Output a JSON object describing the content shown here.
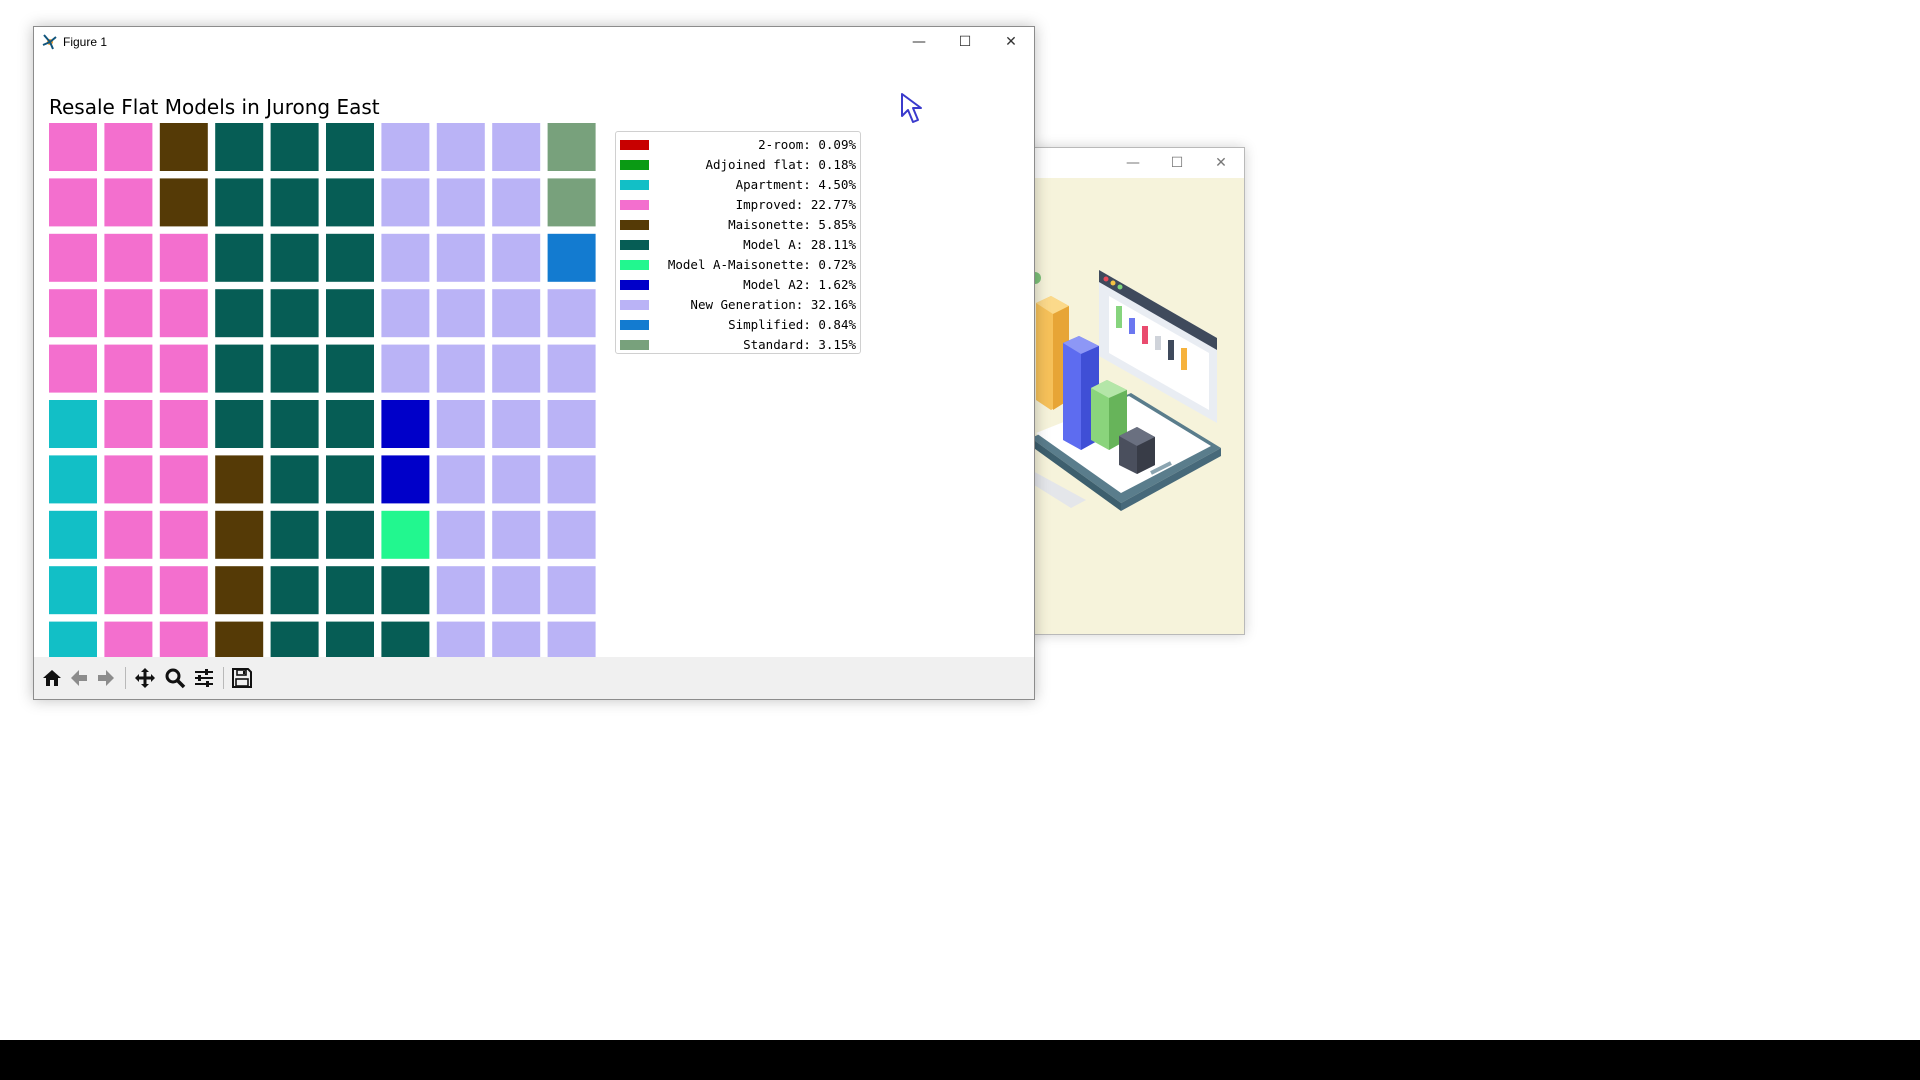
{
  "main_window": {
    "title": "Figure 1",
    "controls": {
      "minimize": "—",
      "maximize": "☐",
      "close": "✕"
    }
  },
  "back_window": {
    "controls": {
      "minimize": "—",
      "maximize": "☐",
      "close": "✕"
    },
    "illustration": "isometric-dashboard-illustration"
  },
  "toolbar": {
    "buttons": [
      "home-icon",
      "back-arrow-icon",
      "forward-arrow-icon",
      "pan-icon",
      "zoom-icon",
      "configure-subplots-icon",
      "save-icon"
    ]
  },
  "chart_data": {
    "type": "waffle",
    "title": "Resale Flat Models in Jurong East",
    "rows": 10,
    "columns": 10,
    "legend_placement": "upper-right",
    "categories": [
      {
        "name": "2-room",
        "label": "2-room: 0.09%",
        "percent": 0.09,
        "color": "#c80000"
      },
      {
        "name": "Adjoined flat",
        "label": "Adjoined flat: 0.18%",
        "percent": 0.18,
        "color": "#0a9a14"
      },
      {
        "name": "Apartment",
        "label": "Apartment: 4.50%",
        "percent": 4.5,
        "color": "#12bfc6"
      },
      {
        "name": "Improved",
        "label": "Improved: 22.77%",
        "percent": 22.77,
        "color": "#f36fce"
      },
      {
        "name": "Maisonette",
        "label": "Maisonette: 5.85%",
        "percent": 5.85,
        "color": "#553a06"
      },
      {
        "name": "Model A",
        "label": "Model A: 28.11%",
        "percent": 28.11,
        "color": "#065d55"
      },
      {
        "name": "Model A-Maisonette",
        "label": "Model A-Maisonette: 0.72%",
        "percent": 0.72,
        "color": "#22f78f"
      },
      {
        "name": "Model A2",
        "label": "Model A2: 1.62%",
        "percent": 1.62,
        "color": "#0000c9"
      },
      {
        "name": "New Generation",
        "label": "New Generation: 32.16%",
        "percent": 32.16,
        "color": "#bab3f6"
      },
      {
        "name": "Simplified",
        "label": "Simplified: 0.84%",
        "percent": 0.84,
        "color": "#137bd0"
      },
      {
        "name": "Standard",
        "label": "Standard: 3.15%",
        "percent": 3.15,
        "color": "#78a17c"
      }
    ],
    "grid": [
      [
        "Improved",
        "Improved",
        "Maisonette",
        "Model A",
        "Model A",
        "Model A",
        "New Generation",
        "New Generation",
        "New Generation",
        "Standard"
      ],
      [
        "Improved",
        "Improved",
        "Maisonette",
        "Model A",
        "Model A",
        "Model A",
        "New Generation",
        "New Generation",
        "New Generation",
        "Standard"
      ],
      [
        "Improved",
        "Improved",
        "Improved",
        "Model A",
        "Model A",
        "Model A",
        "New Generation",
        "New Generation",
        "New Generation",
        "Simplified"
      ],
      [
        "Improved",
        "Improved",
        "Improved",
        "Model A",
        "Model A",
        "Model A",
        "New Generation",
        "New Generation",
        "New Generation",
        "New Generation"
      ],
      [
        "Improved",
        "Improved",
        "Improved",
        "Model A",
        "Model A",
        "Model A",
        "New Generation",
        "New Generation",
        "New Generation",
        "New Generation"
      ],
      [
        "Apartment",
        "Improved",
        "Improved",
        "Model A",
        "Model A",
        "Model A",
        "Model A2",
        "New Generation",
        "New Generation",
        "New Generation"
      ],
      [
        "Apartment",
        "Improved",
        "Improved",
        "Maisonette",
        "Model A",
        "Model A",
        "Model A2",
        "New Generation",
        "New Generation",
        "New Generation"
      ],
      [
        "Apartment",
        "Improved",
        "Improved",
        "Maisonette",
        "Model A",
        "Model A",
        "Model A-Maisonette",
        "New Generation",
        "New Generation",
        "New Generation"
      ],
      [
        "Apartment",
        "Improved",
        "Improved",
        "Maisonette",
        "Model A",
        "Model A",
        "Model A",
        "New Generation",
        "New Generation",
        "New Generation"
      ],
      [
        "Apartment",
        "Improved",
        "Improved",
        "Maisonette",
        "Model A",
        "Model A",
        "Model A",
        "New Generation",
        "New Generation",
        "New Generation"
      ]
    ]
  }
}
